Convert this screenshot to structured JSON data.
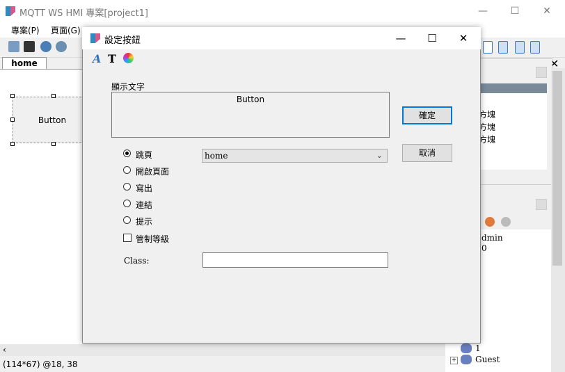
{
  "window": {
    "title": "MQTT WS HMI 專案[project1]",
    "minimize": "—",
    "maximize": "☐",
    "close": "✕"
  },
  "menu": {
    "project": "專案(P)",
    "page": "頁面(G)"
  },
  "tabs": {
    "home": "home"
  },
  "canvas": {
    "selected_button": "Button"
  },
  "status": {
    "text": "(114*67) @18, 38"
  },
  "right_panel": {
    "lines": [
      "方塊",
      "方塊",
      "方塊"
    ],
    "admin": "dmin",
    "zero": "0",
    "tree_one": "1",
    "tree_guest": "Guest",
    "close": "✕"
  },
  "dialog": {
    "title": "設定按鈕",
    "minimize": "—",
    "maximize": "☐",
    "close": "✕",
    "display_text_label": "顯示文字",
    "display_text_value": "Button",
    "ok": "確定",
    "cancel": "取消",
    "radios": [
      "跳頁",
      "開啟頁面",
      "寫出",
      "連結",
      "提示"
    ],
    "selected_radio": "跳頁",
    "page_select_value": "home",
    "permission_label": "管制等級",
    "class_label": "Class:",
    "class_value": ""
  }
}
